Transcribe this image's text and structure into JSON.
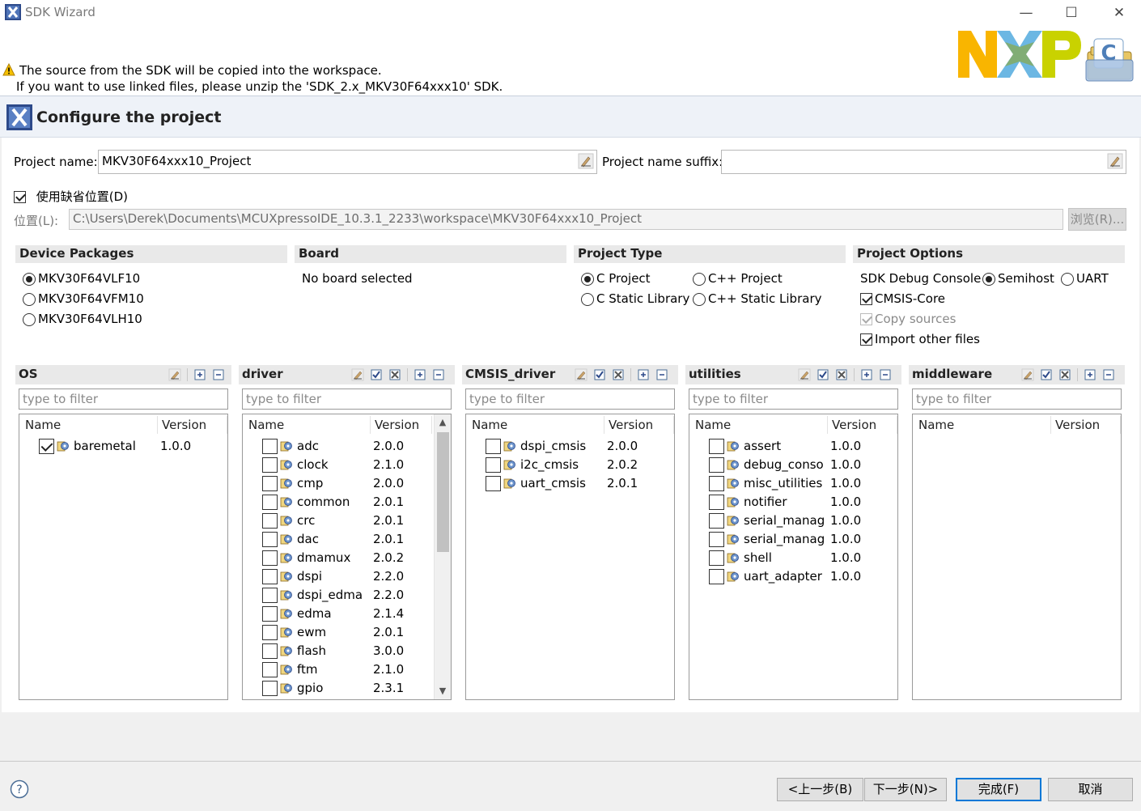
{
  "window": {
    "title": "SDK Wizard",
    "minimize": "—",
    "maximize": "☐",
    "close": "✕"
  },
  "header": {
    "message_line1": "The source from the SDK will be copied into the workspace.",
    "message_line2": "If you want to use linked files, please unzip the 'SDK_2.x_MKV30F64xxx10' SDK.",
    "banner_title": "Configure the project"
  },
  "project": {
    "name_label": "Project name:",
    "name_value": "MKV30F64xxx10_Project",
    "suffix_label": "Project name suffix:",
    "suffix_value": "",
    "use_default_location_label": "使用缺省位置(D)",
    "use_default_location_checked": true,
    "location_label": "位置(L):",
    "location_value": "C:\\Users\\Derek\\Documents\\MCUXpressoIDE_10.3.1_2233\\workspace\\MKV30F64xxx10_Project",
    "browse_label": "浏览(R)..."
  },
  "device_packages": {
    "header": "Device Packages",
    "options": [
      {
        "label": "MKV30F64VLF10",
        "selected": true
      },
      {
        "label": "MKV30F64VFM10",
        "selected": false
      },
      {
        "label": "MKV30F64VLH10",
        "selected": false
      }
    ]
  },
  "board": {
    "header": "Board",
    "value": "No board selected"
  },
  "project_type": {
    "header": "Project Type",
    "options": [
      {
        "label": "C Project",
        "selected": true
      },
      {
        "label": "C++ Project",
        "selected": false
      },
      {
        "label": "C Static Library",
        "selected": false
      },
      {
        "label": "C++ Static Library",
        "selected": false
      }
    ]
  },
  "project_options": {
    "header": "Project Options",
    "debug_console_label": "SDK Debug Console",
    "semihost_label": "Semihost",
    "uart_label": "UART",
    "cmsis_core_label": "CMSIS-Core",
    "copy_sources_label": "Copy sources",
    "import_other_files_label": "Import other files"
  },
  "panels": [
    {
      "title": "OS",
      "filter_placeholder": "type to filter",
      "col_name": "Name",
      "col_version": "Version",
      "rows": [
        {
          "name": "baremetal",
          "version": "1.0.0",
          "checked": true
        }
      ]
    },
    {
      "title": "driver",
      "filter_placeholder": "type to filter",
      "col_name": "Name",
      "col_version": "Version",
      "rows": [
        {
          "name": "adc",
          "version": "2.0.0",
          "checked": false
        },
        {
          "name": "clock",
          "version": "2.1.0",
          "checked": false
        },
        {
          "name": "cmp",
          "version": "2.0.0",
          "checked": false
        },
        {
          "name": "common",
          "version": "2.0.1",
          "checked": false
        },
        {
          "name": "crc",
          "version": "2.0.1",
          "checked": false
        },
        {
          "name": "dac",
          "version": "2.0.1",
          "checked": false
        },
        {
          "name": "dmamux",
          "version": "2.0.2",
          "checked": false
        },
        {
          "name": "dspi",
          "version": "2.2.0",
          "checked": false
        },
        {
          "name": "dspi_edma",
          "version": "2.2.0",
          "checked": false
        },
        {
          "name": "edma",
          "version": "2.1.4",
          "checked": false
        },
        {
          "name": "ewm",
          "version": "2.0.1",
          "checked": false
        },
        {
          "name": "flash",
          "version": "3.0.0",
          "checked": false
        },
        {
          "name": "ftm",
          "version": "2.1.0",
          "checked": false
        },
        {
          "name": "gpio",
          "version": "2.3.1",
          "checked": false
        }
      ]
    },
    {
      "title": "CMSIS_driver",
      "filter_placeholder": "type to filter",
      "col_name": "Name",
      "col_version": "Version",
      "rows": [
        {
          "name": "dspi_cmsis",
          "version": "2.0.0",
          "checked": false
        },
        {
          "name": "i2c_cmsis",
          "version": "2.0.2",
          "checked": false
        },
        {
          "name": "uart_cmsis",
          "version": "2.0.1",
          "checked": false
        }
      ]
    },
    {
      "title": "utilities",
      "filter_placeholder": "type to filter",
      "col_name": "Name",
      "col_version": "Version",
      "rows": [
        {
          "name": "assert",
          "version": "1.0.0",
          "checked": false
        },
        {
          "name": "debug_consol",
          "version": "1.0.0",
          "checked": false
        },
        {
          "name": "misc_utilities",
          "version": "1.0.0",
          "checked": false
        },
        {
          "name": "notifier",
          "version": "1.0.0",
          "checked": false
        },
        {
          "name": "serial_manage",
          "version": "1.0.0",
          "checked": false
        },
        {
          "name": "serial_manage",
          "version": "1.0.0",
          "checked": false
        },
        {
          "name": "shell",
          "version": "1.0.0",
          "checked": false
        },
        {
          "name": "uart_adapter",
          "version": "1.0.0",
          "checked": false
        }
      ]
    },
    {
      "title": "middleware",
      "filter_placeholder": "type to filter",
      "col_name": "Name",
      "col_version": "Version",
      "rows": []
    }
  ],
  "buttons": {
    "back": "<上一步(B)",
    "next": "下一步(N)>",
    "finish": "完成(F)",
    "cancel": "取消"
  },
  "icons": {
    "help": "help-icon",
    "warning": "warning-icon",
    "clear": "clear-edit-icon",
    "select_all": "select-all-icon",
    "deselect_all": "deselect-all-icon",
    "expand_all": "expand-all-icon",
    "collapse_all": "collapse-all-icon",
    "component": "component-icon"
  },
  "colors": {
    "accent": "#0078d7",
    "nxp_yellow": "#f9b500",
    "nxp_green": "#c9d200",
    "nxp_blue": "#6cb7e3"
  }
}
